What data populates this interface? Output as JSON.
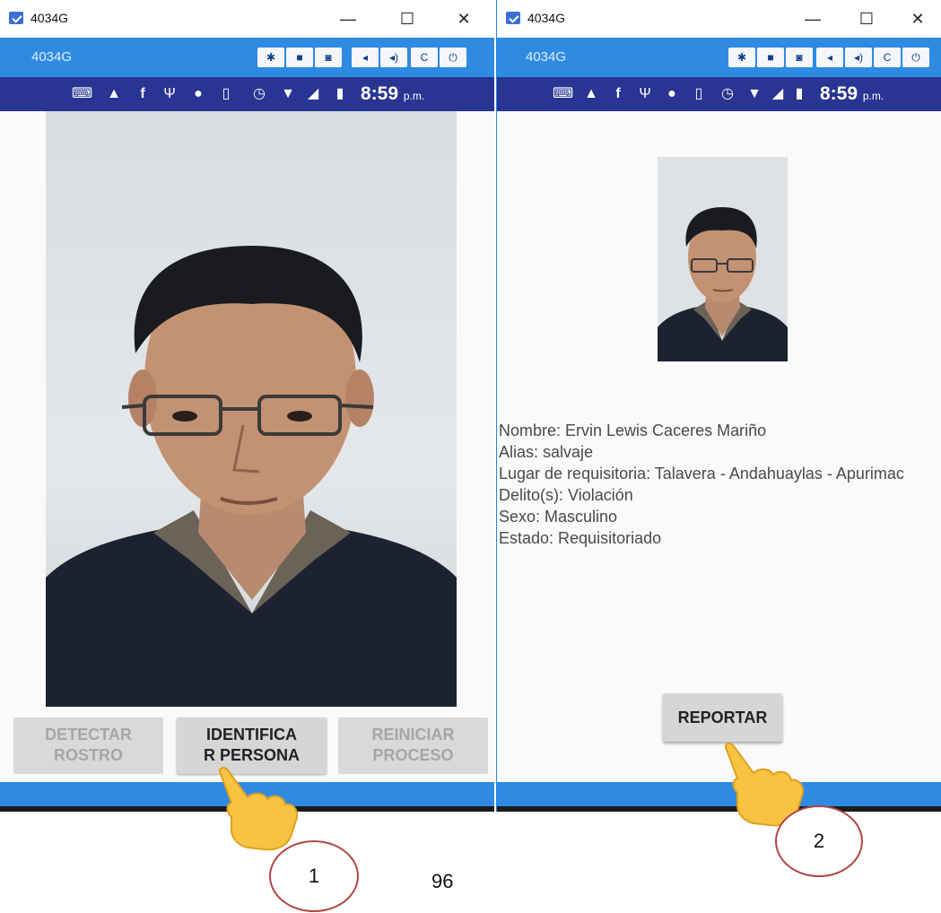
{
  "window1": {
    "title": "4034G",
    "device_name": "4034G",
    "controls": {
      "minimize": "—",
      "maximize": "☐",
      "close": "✕"
    },
    "toolbar_icons": [
      "settings-icon",
      "video-icon",
      "camera-icon",
      "volume-down-icon",
      "volume-up-icon",
      "rotate-icon",
      "power-icon"
    ],
    "status_time": "8:59",
    "status_ampm": "p.m.",
    "buttons": {
      "detect_line1": "DETECTAR",
      "detect_line2": "ROSTRO",
      "identify_line1": "IDENTIFICA",
      "identify_line2": "R PERSONA",
      "restart_line1": "REINICIAR",
      "restart_line2": "PROCESO"
    }
  },
  "window2": {
    "title": "4034G",
    "device_name": "4034G",
    "controls": {
      "minimize": "—",
      "maximize": "☐",
      "close": "✕"
    },
    "status_time": "8:59",
    "status_ampm": "p.m.",
    "info": {
      "nombre": "Nombre: Ervin Lewis Caceres Mariño",
      "alias": "Alias: salvaje",
      "lugar": "Lugar de requisitoria: Talavera - Andahuaylas - Apurimac",
      "delito": "Delito(s): Violación",
      "sexo": "Sexo: Masculino",
      "estado": "Estado: Requisitoriado"
    },
    "report_label": "REPORTAR"
  },
  "callouts": {
    "first": "1",
    "second": "2"
  },
  "page_number": "96",
  "colors": {
    "toolbar_blue": "#2f8ae2",
    "status_indigo": "#283593",
    "button_gray": "#d6d6d6",
    "callout_red": "#b04444"
  }
}
